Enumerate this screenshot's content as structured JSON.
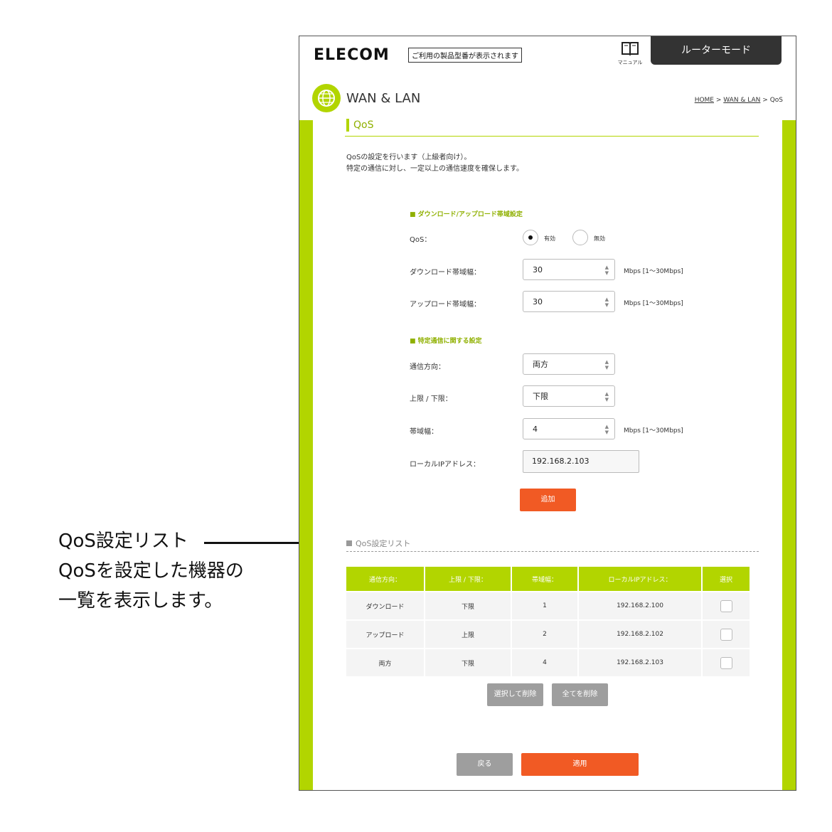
{
  "annotation": {
    "line1": "QoS設定リスト",
    "line2": "QoSを設定した機器の",
    "line3": "一覧を表示します。"
  },
  "header": {
    "logo": "ELECOM",
    "model_text": "ご利用の製品型番が表示されます",
    "manual_label": "マニュアル",
    "mode_button": "ルーターモード",
    "icons": {
      "manual": "book-icon",
      "section": "globe-icon"
    }
  },
  "page": {
    "section_title": "WAN & LAN",
    "breadcrumb": {
      "home": "HOME",
      "sep1": " > ",
      "wanlan": "WAN & LAN",
      "sep2": " > ",
      "current": "QoS"
    },
    "heading": "QoS",
    "desc_line1": "QoSの設定を行います（上級者向け）。",
    "desc_line2": "特定の通信に対し、一定以上の通信速度を確保します。"
  },
  "bandwidth": {
    "heading": "■ ダウンロード/アップロード帯域設定",
    "qos_label": "QoS：",
    "qos_on": "有効",
    "qos_off": "無効",
    "download_label": "ダウンロード帯域幅：",
    "download_value": "30",
    "download_unit": "Mbps [1～30Mbps]",
    "upload_label": "アップロード帯域幅：",
    "upload_value": "30",
    "upload_unit": "Mbps [1～30Mbps]"
  },
  "specific": {
    "heading": "■ 特定通信に関する設定",
    "direction_label": "通信方向：",
    "direction_value": "両方",
    "limit_label": "上限 / 下限：",
    "limit_value": "下限",
    "band_label": "帯域幅：",
    "band_value": "4",
    "band_unit": "Mbps [1～30Mbps]",
    "ip_label": "ローカルIPアドレス：",
    "ip_value": "192.168.2.103",
    "add_button": "追加"
  },
  "list": {
    "heading": "QoS設定リスト",
    "columns": [
      "通信方向：",
      "上限 / 下限：",
      "帯域幅：",
      "ローカルIPアドレス：",
      "選択"
    ],
    "rows": [
      [
        "ダウンロード",
        "下限",
        "1",
        "192.168.2.100"
      ],
      [
        "アップロード",
        "上限",
        "2",
        "192.168.2.102"
      ],
      [
        "両方",
        "下限",
        "4",
        "192.168.2.103"
      ]
    ],
    "delete_selected": "選択して削除",
    "delete_all": "全てを削除"
  },
  "footer": {
    "back": "戻る",
    "apply": "適用"
  },
  "colors": {
    "accent_green": "#b2d500",
    "orange": "#f15a24",
    "gray_button": "#9e9e9e",
    "dark": "#333333"
  }
}
